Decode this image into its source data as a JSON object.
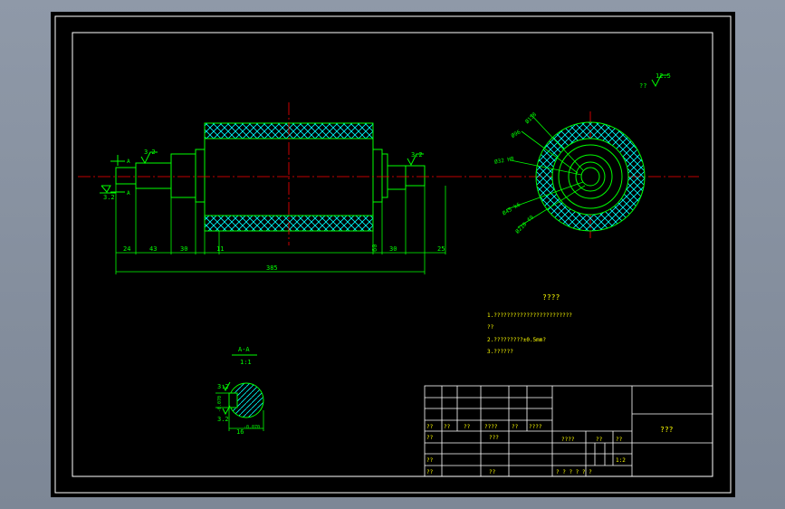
{
  "colors": {
    "background": "#000000",
    "frame": "#ffffff",
    "part": "#00ff00",
    "hatch": "#00ffff",
    "centerline": "#ff0000",
    "dimension": "#00ff00",
    "text": "#ffff00"
  },
  "section_view": {
    "title": "A-A",
    "scale": "1:1",
    "roughness_top": "3.2",
    "roughness_bottom": "3.2",
    "dim_width": "16",
    "dim_width_tol": "-0.070",
    "dim_height_tol": "-0.070"
  },
  "main_view": {
    "roughness_left": "3.2",
    "roughness_right": "3.2",
    "roughness_datum": "3.2",
    "section_mark_top": "A",
    "section_mark_bottom": "A",
    "dims_bottom": [
      "24",
      "43",
      "30",
      "11",
      "60",
      "30",
      "25"
    ],
    "overall_length": "385"
  },
  "end_view": {
    "roughness_general": "12.5",
    "roughness_general_label": "??",
    "dia_labels": [
      "Ø158",
      "Ø96",
      "Ø32 H8",
      "Ø45 k6",
      "Ø210 f9"
    ]
  },
  "notes": {
    "heading": "????",
    "lines": [
      "1.????????????????????????",
      "??",
      "2.?????????±0.5mm?",
      "3.??????"
    ]
  },
  "title_block": {
    "drawing_name": "???",
    "row_sign": [
      "??",
      "??",
      "??",
      "????",
      "??",
      "????"
    ],
    "label_design": "??",
    "label_check": "??",
    "label_approve": "??",
    "label_process": "??",
    "label_std": "???",
    "stage": "????",
    "weight": "??",
    "scale_label": "??",
    "scale_value": "1:2",
    "sheet_line": "?  ?  ?    ?  ?  ?"
  }
}
